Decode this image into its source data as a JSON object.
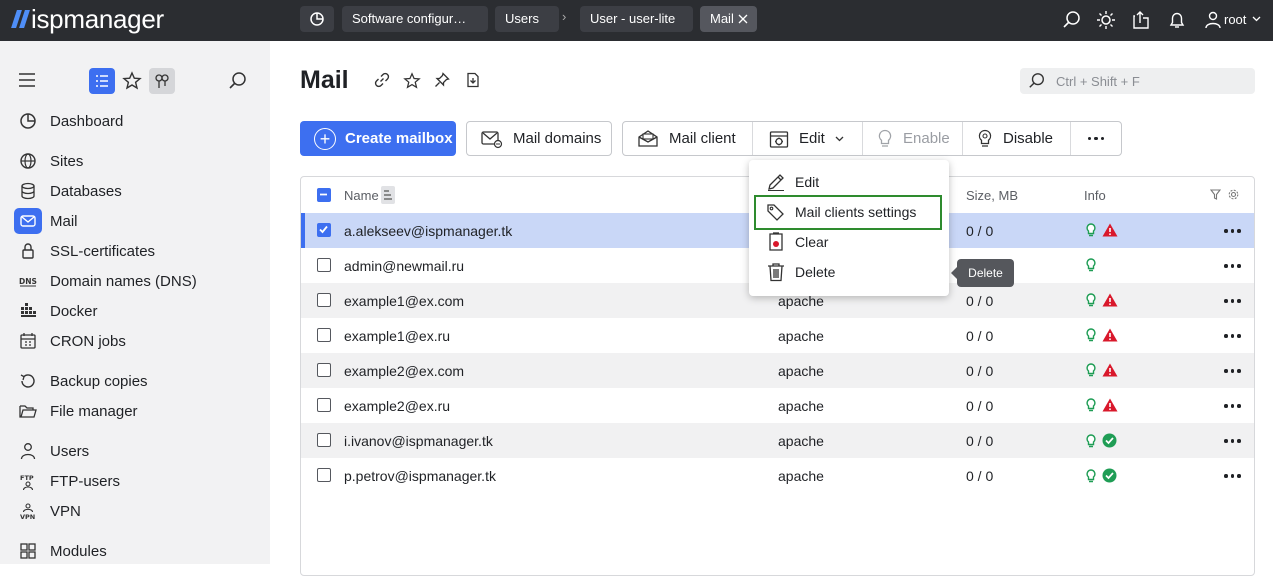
{
  "topbar": {
    "logo_text": "ispmanager",
    "breadcrumbs": [
      "Software configur…",
      "Users",
      "User - user-lite",
      "Mail"
    ],
    "separator": "›",
    "user": "root",
    "icons": [
      "search-icon",
      "theme-sun-icon",
      "export-icon",
      "bell-icon",
      "user-icon"
    ]
  },
  "sidebar": {
    "items": [
      {
        "label": "Dashboard",
        "icon": "dashboard-icon"
      },
      {
        "label": "Sites",
        "icon": "globe-icon"
      },
      {
        "label": "Databases",
        "icon": "database-icon"
      },
      {
        "label": "Mail",
        "icon": "mail-icon",
        "active": true
      },
      {
        "label": "SSL-certificates",
        "icon": "lock-icon"
      },
      {
        "label": "Domain names (DNS)",
        "icon": "dns-icon"
      },
      {
        "label": "Docker",
        "icon": "docker-icon"
      },
      {
        "label": "CRON jobs",
        "icon": "calendar-icon"
      },
      {
        "label": "Backup copies",
        "icon": "backup-icon"
      },
      {
        "label": "File manager",
        "icon": "folder-icon"
      },
      {
        "label": "Users",
        "icon": "user-icon"
      },
      {
        "label": "FTP-users",
        "icon": "ftp-icon"
      },
      {
        "label": "VPN",
        "icon": "vpn-icon"
      },
      {
        "label": "Modules",
        "icon": "modules-icon"
      }
    ]
  },
  "main": {
    "title": "Mail",
    "search_placeholder": "Ctrl + Shift + F",
    "toolbar": {
      "create": "Create mailbox",
      "domains": "Mail domains",
      "client": "Mail client",
      "edit": "Edit",
      "enable": "Enable",
      "disable": "Disable"
    },
    "table": {
      "columns": {
        "name": "Name",
        "size": "Size, MB",
        "info": "Info"
      },
      "rows": [
        {
          "name": "a.alekseev@ispmanager.tk",
          "owner": "",
          "size": "0 / 0",
          "status": "warning",
          "selected": true
        },
        {
          "name": "admin@newmail.ru",
          "owner": "",
          "size": "",
          "status": "none"
        },
        {
          "name": "example1@ex.com",
          "owner": "apache",
          "size": "0 / 0",
          "status": "warning"
        },
        {
          "name": "example1@ex.ru",
          "owner": "apache",
          "size": "0 / 0",
          "status": "warning"
        },
        {
          "name": "example2@ex.com",
          "owner": "apache",
          "size": "0 / 0",
          "status": "warning"
        },
        {
          "name": "example2@ex.ru",
          "owner": "apache",
          "size": "0 / 0",
          "status": "warning"
        },
        {
          "name": "i.ivanov@ispmanager.tk",
          "owner": "apache",
          "size": "0 / 0",
          "status": "ok"
        },
        {
          "name": "p.petrov@ispmanager.tk",
          "owner": "apache",
          "size": "0 / 0",
          "status": "ok"
        }
      ]
    },
    "dropdown": {
      "items": [
        "Edit",
        "Mail clients settings",
        "Clear",
        "Delete"
      ]
    },
    "tooltip": "Delete"
  },
  "colors": {
    "accent": "#3d6ff0",
    "topbar": "#2b2d31",
    "sidebar": "#f2f2f3",
    "warning": "#d9182b",
    "ok": "#1f9d55",
    "highlight": "#2e8b2e"
  }
}
